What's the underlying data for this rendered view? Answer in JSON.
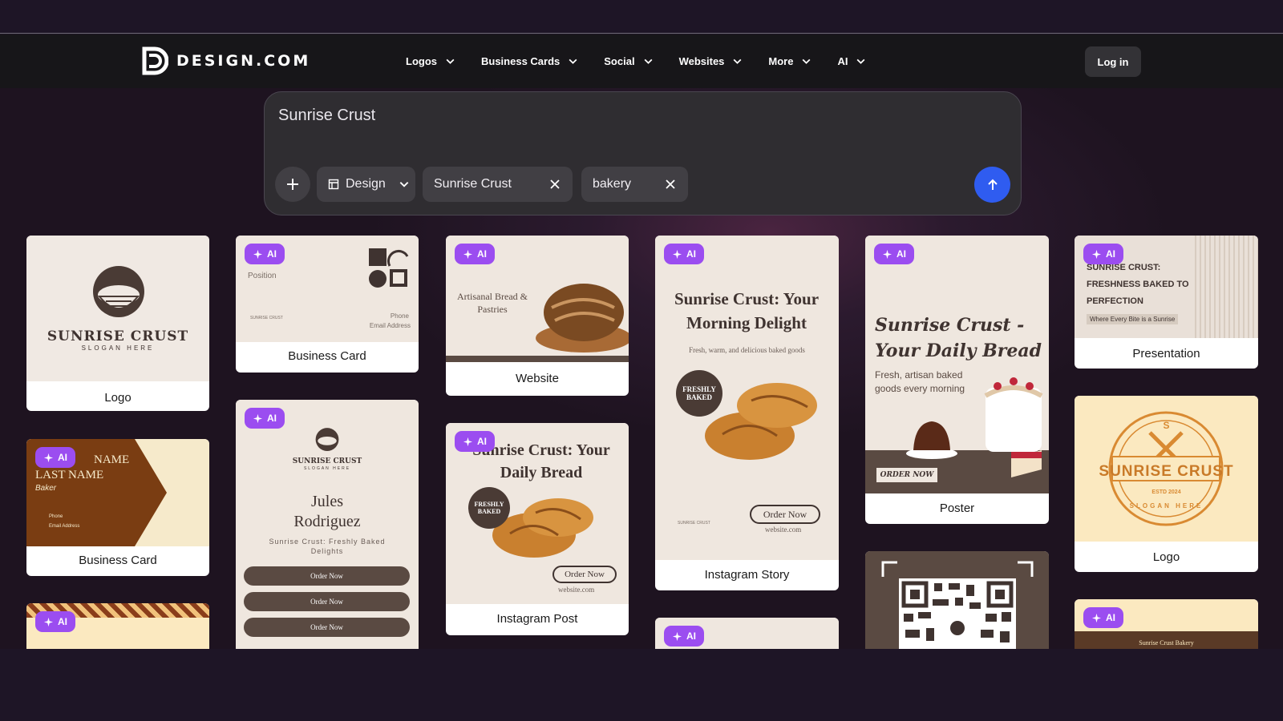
{
  "brand": {
    "name": "DESIGN.COM"
  },
  "nav": {
    "items": [
      "Logos",
      "Business Cards",
      "Social",
      "Websites",
      "More",
      "AI"
    ],
    "login": "Log in"
  },
  "search": {
    "query": "Sunrise Crust",
    "type_selector": "Design",
    "tags": [
      "Sunrise Crust",
      "bakery"
    ]
  },
  "ai_badge": "AI",
  "cards": {
    "logo1": {
      "label": "Logo",
      "brand": "SUNRISE CRUST",
      "slogan": "SLOGAN HERE"
    },
    "bizcard1": {
      "label": "Business Card",
      "position": "Position",
      "phone": "Phone",
      "email": "Email Address",
      "brand": "SUNRISE CRUST"
    },
    "website": {
      "label": "Website",
      "headline": "Artisanal Bread & Pastries"
    },
    "igstory": {
      "label": "Instagram Story",
      "title": "Sunrise Crust: Your Morning Delight",
      "sub": "Fresh, warm, and delicious baked goods",
      "badge": "FRESHLY BAKED",
      "cta": "Order Now",
      "url": "website.com",
      "brand": "SUNRISE CRUST"
    },
    "poster": {
      "label": "Poster",
      "title": "Sunrise Crust - Your Daily Bread",
      "sub": "Fresh, artisan baked goods every morning",
      "cta": "ORDER NOW"
    },
    "presentation": {
      "label": "Presentation",
      "title": "SUNRISE CRUST: FRESHNESS BAKED TO PERFECTION",
      "tagline": "Where Every Bite is a Sunrise"
    },
    "bizcard2": {
      "label": "Business Card",
      "name": "NAME",
      "last": "LAST NAME",
      "role": "Baker",
      "phone": "Phone",
      "email": "Email Address"
    },
    "linkbio": {
      "brand": "SUNRISE CRUST",
      "slogan": "SLOGAN HERE",
      "name1": "Jules",
      "name2": "Rodriguez",
      "tagline": "Sunrise Crust: Freshly Baked Delights",
      "buttons": [
        "Order Now",
        "Order Now",
        "Order Now"
      ]
    },
    "igpost": {
      "label": "Instagram Post",
      "title": "Sunrise Crust: Your Daily Bread",
      "badge": "FRESHLY BAKED",
      "cta": "Order Now",
      "url": "website.com"
    },
    "logo2": {
      "label": "Logo",
      "brand": "SUNRISE CRUST",
      "est": "ESTD 2024",
      "slogan": "SLOGAN HERE",
      "letter": "S"
    },
    "web2": {
      "title": "Sunrise Crust Bakery"
    }
  }
}
